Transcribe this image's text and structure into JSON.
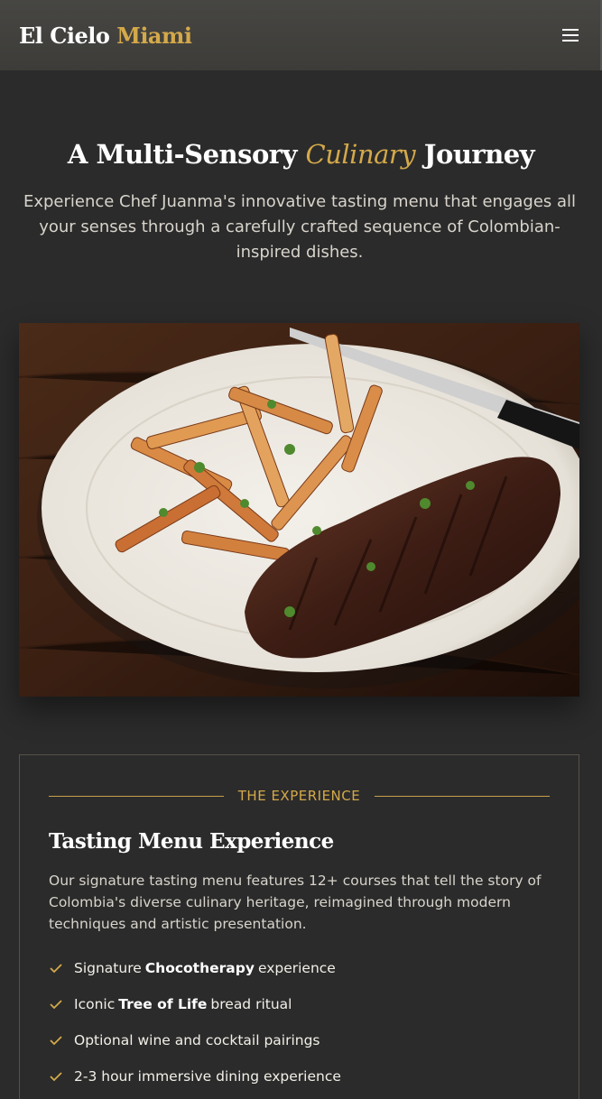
{
  "nav": {
    "logo_main": "El Cielo",
    "logo_accent": "Miami",
    "menu_icon": "hamburger-menu-icon"
  },
  "hero": {
    "title_before": "A Multi-Sensory",
    "title_highlight": "Culinary",
    "title_after": "Journey",
    "subtitle": "Experience Chef Juanma's innovative tasting menu that engages all your senses through a carefully crafted sequence of Colombian-inspired dishes.",
    "image_alt": "Plate of grilled steak with fries and herbs"
  },
  "experience": {
    "eyebrow": "THE EXPERIENCE",
    "title": "Tasting Menu Experience",
    "description": "Our signature tasting menu features 12+ courses that tell the story of Colombia's diverse culinary heritage, reimagined through modern techniques and artistic presentation.",
    "features": [
      {
        "before": "Signature",
        "bold": "Chocotherapy",
        "after": "experience"
      },
      {
        "before": "Iconic",
        "bold": "Tree of Life",
        "after": "bread ritual"
      },
      {
        "before": "Optional wine and cocktail pairings",
        "bold": "",
        "after": ""
      },
      {
        "before": "2-3 hour immersive dining experience",
        "bold": "",
        "after": ""
      }
    ]
  },
  "colors": {
    "accent": "#d4a94a",
    "background": "#2b2b2b",
    "header": "#42413e"
  }
}
